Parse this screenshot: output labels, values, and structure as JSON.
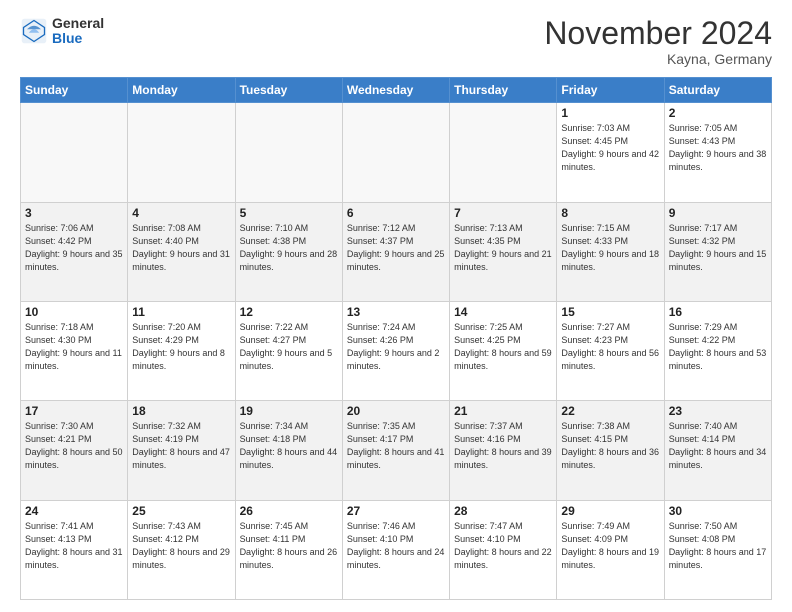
{
  "logo": {
    "general": "General",
    "blue": "Blue"
  },
  "header": {
    "month": "November 2024",
    "location": "Kayna, Germany"
  },
  "weekdays": [
    "Sunday",
    "Monday",
    "Tuesday",
    "Wednesday",
    "Thursday",
    "Friday",
    "Saturday"
  ],
  "weeks": [
    [
      {
        "day": "",
        "info": ""
      },
      {
        "day": "",
        "info": ""
      },
      {
        "day": "",
        "info": ""
      },
      {
        "day": "",
        "info": ""
      },
      {
        "day": "",
        "info": ""
      },
      {
        "day": "1",
        "info": "Sunrise: 7:03 AM\nSunset: 4:45 PM\nDaylight: 9 hours\nand 42 minutes."
      },
      {
        "day": "2",
        "info": "Sunrise: 7:05 AM\nSunset: 4:43 PM\nDaylight: 9 hours\nand 38 minutes."
      }
    ],
    [
      {
        "day": "3",
        "info": "Sunrise: 7:06 AM\nSunset: 4:42 PM\nDaylight: 9 hours\nand 35 minutes."
      },
      {
        "day": "4",
        "info": "Sunrise: 7:08 AM\nSunset: 4:40 PM\nDaylight: 9 hours\nand 31 minutes."
      },
      {
        "day": "5",
        "info": "Sunrise: 7:10 AM\nSunset: 4:38 PM\nDaylight: 9 hours\nand 28 minutes."
      },
      {
        "day": "6",
        "info": "Sunrise: 7:12 AM\nSunset: 4:37 PM\nDaylight: 9 hours\nand 25 minutes."
      },
      {
        "day": "7",
        "info": "Sunrise: 7:13 AM\nSunset: 4:35 PM\nDaylight: 9 hours\nand 21 minutes."
      },
      {
        "day": "8",
        "info": "Sunrise: 7:15 AM\nSunset: 4:33 PM\nDaylight: 9 hours\nand 18 minutes."
      },
      {
        "day": "9",
        "info": "Sunrise: 7:17 AM\nSunset: 4:32 PM\nDaylight: 9 hours\nand 15 minutes."
      }
    ],
    [
      {
        "day": "10",
        "info": "Sunrise: 7:18 AM\nSunset: 4:30 PM\nDaylight: 9 hours\nand 11 minutes."
      },
      {
        "day": "11",
        "info": "Sunrise: 7:20 AM\nSunset: 4:29 PM\nDaylight: 9 hours\nand 8 minutes."
      },
      {
        "day": "12",
        "info": "Sunrise: 7:22 AM\nSunset: 4:27 PM\nDaylight: 9 hours\nand 5 minutes."
      },
      {
        "day": "13",
        "info": "Sunrise: 7:24 AM\nSunset: 4:26 PM\nDaylight: 9 hours\nand 2 minutes."
      },
      {
        "day": "14",
        "info": "Sunrise: 7:25 AM\nSunset: 4:25 PM\nDaylight: 8 hours\nand 59 minutes."
      },
      {
        "day": "15",
        "info": "Sunrise: 7:27 AM\nSunset: 4:23 PM\nDaylight: 8 hours\nand 56 minutes."
      },
      {
        "day": "16",
        "info": "Sunrise: 7:29 AM\nSunset: 4:22 PM\nDaylight: 8 hours\nand 53 minutes."
      }
    ],
    [
      {
        "day": "17",
        "info": "Sunrise: 7:30 AM\nSunset: 4:21 PM\nDaylight: 8 hours\nand 50 minutes."
      },
      {
        "day": "18",
        "info": "Sunrise: 7:32 AM\nSunset: 4:19 PM\nDaylight: 8 hours\nand 47 minutes."
      },
      {
        "day": "19",
        "info": "Sunrise: 7:34 AM\nSunset: 4:18 PM\nDaylight: 8 hours\nand 44 minutes."
      },
      {
        "day": "20",
        "info": "Sunrise: 7:35 AM\nSunset: 4:17 PM\nDaylight: 8 hours\nand 41 minutes."
      },
      {
        "day": "21",
        "info": "Sunrise: 7:37 AM\nSunset: 4:16 PM\nDaylight: 8 hours\nand 39 minutes."
      },
      {
        "day": "22",
        "info": "Sunrise: 7:38 AM\nSunset: 4:15 PM\nDaylight: 8 hours\nand 36 minutes."
      },
      {
        "day": "23",
        "info": "Sunrise: 7:40 AM\nSunset: 4:14 PM\nDaylight: 8 hours\nand 34 minutes."
      }
    ],
    [
      {
        "day": "24",
        "info": "Sunrise: 7:41 AM\nSunset: 4:13 PM\nDaylight: 8 hours\nand 31 minutes."
      },
      {
        "day": "25",
        "info": "Sunrise: 7:43 AM\nSunset: 4:12 PM\nDaylight: 8 hours\nand 29 minutes."
      },
      {
        "day": "26",
        "info": "Sunrise: 7:45 AM\nSunset: 4:11 PM\nDaylight: 8 hours\nand 26 minutes."
      },
      {
        "day": "27",
        "info": "Sunrise: 7:46 AM\nSunset: 4:10 PM\nDaylight: 8 hours\nand 24 minutes."
      },
      {
        "day": "28",
        "info": "Sunrise: 7:47 AM\nSunset: 4:10 PM\nDaylight: 8 hours\nand 22 minutes."
      },
      {
        "day": "29",
        "info": "Sunrise: 7:49 AM\nSunset: 4:09 PM\nDaylight: 8 hours\nand 19 minutes."
      },
      {
        "day": "30",
        "info": "Sunrise: 7:50 AM\nSunset: 4:08 PM\nDaylight: 8 hours\nand 17 minutes."
      }
    ]
  ]
}
